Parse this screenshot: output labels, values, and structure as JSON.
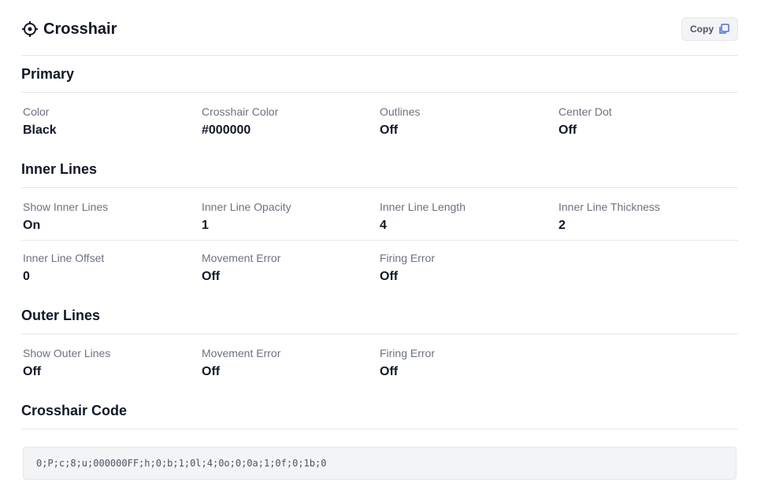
{
  "header": {
    "title": "Crosshair",
    "icon": "crosshair-icon",
    "copy_label": "Copy",
    "copy_icon": "copy-icon"
  },
  "sections": {
    "primary": {
      "title": "Primary",
      "fields": [
        {
          "label": "Color",
          "value": "Black"
        },
        {
          "label": "Crosshair Color",
          "value": "#000000"
        },
        {
          "label": "Outlines",
          "value": "Off"
        },
        {
          "label": "Center Dot",
          "value": "Off"
        }
      ]
    },
    "inner": {
      "title": "Inner Lines",
      "fields": [
        {
          "label": "Show Inner Lines",
          "value": "On"
        },
        {
          "label": "Inner Line Opacity",
          "value": "1"
        },
        {
          "label": "Inner Line Length",
          "value": "4"
        },
        {
          "label": "Inner Line Thickness",
          "value": "2"
        },
        {
          "label": "Inner Line Offset",
          "value": "0"
        },
        {
          "label": "Movement Error",
          "value": "Off"
        },
        {
          "label": "Firing Error",
          "value": "Off"
        }
      ]
    },
    "outer": {
      "title": "Outer Lines",
      "fields": [
        {
          "label": "Show Outer Lines",
          "value": "Off"
        },
        {
          "label": "Movement Error",
          "value": "Off"
        },
        {
          "label": "Firing Error",
          "value": "Off"
        }
      ]
    },
    "code": {
      "title": "Crosshair Code",
      "value": "0;P;c;8;u;000000FF;h;0;b;1;0l;4;0o;0;0a;1;0f;0;1b;0"
    }
  },
  "colors": {
    "text": "#111827",
    "muted": "#6b7280",
    "divider": "#e5e7eb",
    "code_bg": "#f3f4f6"
  }
}
